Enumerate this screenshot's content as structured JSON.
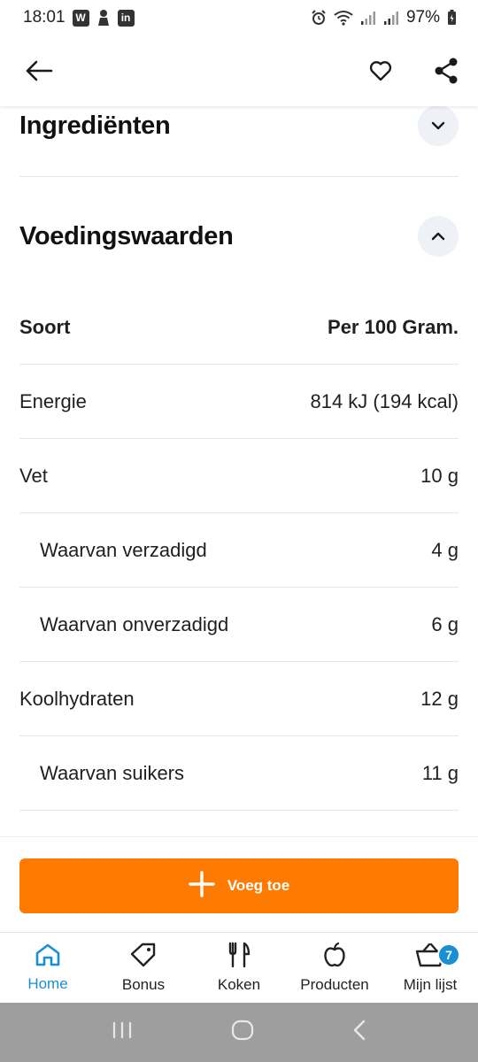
{
  "status_bar": {
    "time": "18:01",
    "battery": "97%",
    "app_icons": [
      "W",
      "person",
      "in"
    ],
    "icons": [
      "alarm-icon",
      "wifi-icon",
      "signal-icon",
      "signal-icon",
      "battery-icon"
    ]
  },
  "app_bar": {
    "icons": [
      "back-arrow-icon",
      "heart-icon",
      "share-icon"
    ]
  },
  "sections": {
    "ingredients": {
      "title": "Ingrediënten",
      "state": "collapsed"
    },
    "nutrition": {
      "title": "Voedingswaarden",
      "state": "expanded"
    }
  },
  "nutrition": {
    "header": {
      "label": "Soort",
      "value": "Per 100 Gram."
    },
    "rows": [
      {
        "label": "Energie",
        "value": "814 kJ (194 kcal)",
        "indent": false
      },
      {
        "label": "Vet",
        "value": "10 g",
        "indent": false
      },
      {
        "label": "Waarvan verzadigd",
        "value": "4 g",
        "indent": true
      },
      {
        "label": "Waarvan onverzadigd",
        "value": "6 g",
        "indent": true
      },
      {
        "label": "Koolhydraten",
        "value": "12 g",
        "indent": false
      },
      {
        "label": "Waarvan suikers",
        "value": "11 g",
        "indent": true
      }
    ]
  },
  "add_button": {
    "label": "Voeg toe",
    "color": "#ff7a00"
  },
  "bottom_nav": {
    "items": [
      {
        "label": "Home",
        "icon": "home-icon",
        "active": true
      },
      {
        "label": "Bonus",
        "icon": "tag-icon",
        "active": false
      },
      {
        "label": "Koken",
        "icon": "cutlery-icon",
        "active": false
      },
      {
        "label": "Producten",
        "icon": "apple-icon",
        "active": false
      },
      {
        "label": "Mijn lijst",
        "icon": "basket-icon",
        "active": false,
        "badge": "7"
      }
    ],
    "active_color": "#1a8fd1"
  },
  "system_nav": {
    "icons": [
      "recents-icon",
      "home-circle-icon",
      "back-chevron-icon"
    ]
  }
}
